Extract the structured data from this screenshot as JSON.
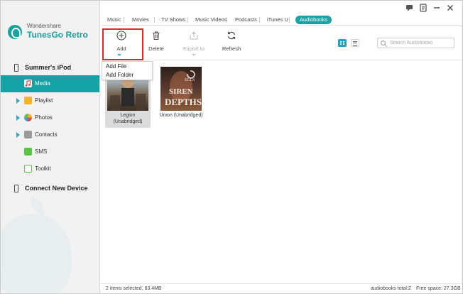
{
  "brand": {
    "company": "Wondershare",
    "product": "TunesGo Retro",
    "accent": "#1aa2a4"
  },
  "sidebar": {
    "device_name": "Summer's iPod",
    "items": [
      {
        "label": "Media",
        "icon": "music-icon",
        "active": true
      },
      {
        "label": "Playlist",
        "icon": "playlist-icon"
      },
      {
        "label": "Photos",
        "icon": "photos-icon"
      },
      {
        "label": "Contacts",
        "icon": "contacts-icon"
      },
      {
        "label": "SMS",
        "icon": "sms-icon"
      },
      {
        "label": "Toolkit",
        "icon": "toolkit-icon"
      }
    ],
    "connect_label": "Connect New Device"
  },
  "tabs": [
    "Music",
    "Movies",
    "TV Shows",
    "Music Videos",
    "Podcasts",
    "iTunes U",
    "Audiobooks"
  ],
  "active_tab": "Audiobooks",
  "toolbar": {
    "add": "Add",
    "delete": "Delete",
    "export": "Export to",
    "refresh": "Refresh"
  },
  "search": {
    "placeholder": "Search Audiobooks"
  },
  "add_menu": {
    "add_file": "Add File",
    "add_folder": "Add Folder"
  },
  "items": [
    {
      "title": "Legion",
      "subtitle": "(Unabridged)",
      "selected": true
    },
    {
      "title": "Union (Unabridged)",
      "subtitle": "",
      "selected": false,
      "cover_text": [
        "ELLS",
        "SIREN",
        "DEPTHS"
      ]
    }
  ],
  "status": {
    "selected": "2 items selected, 83.4MB",
    "total": "audiobooks total:2",
    "free": "Free space: 27.3GB"
  }
}
